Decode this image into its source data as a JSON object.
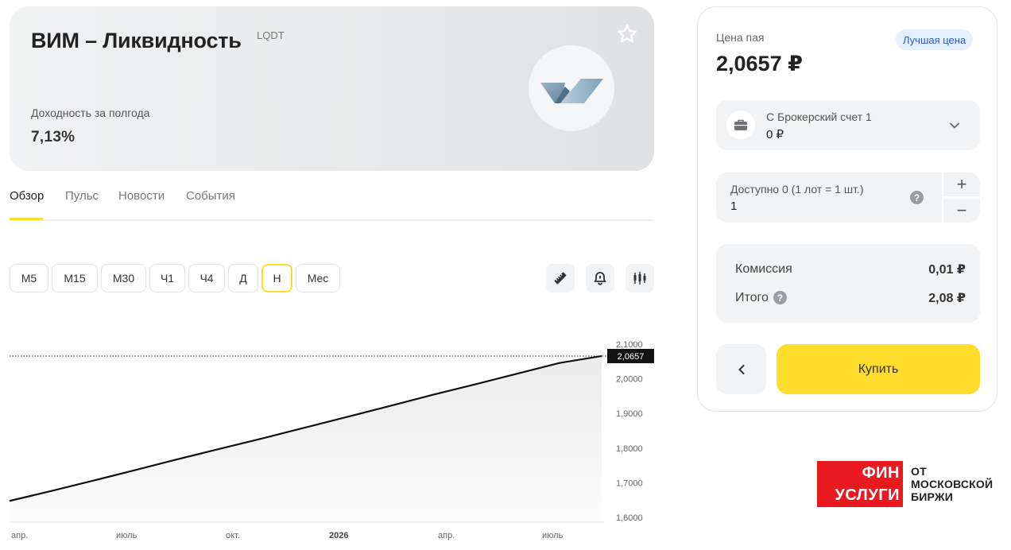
{
  "hero": {
    "title": "ВИМ – Ликвидность",
    "ticker": "LQDT",
    "yield_label": "Доходность за полгода",
    "yield_value": "7,13%"
  },
  "tabs": [
    {
      "label": "Обзор",
      "active": true
    },
    {
      "label": "Пульс",
      "active": false
    },
    {
      "label": "Новости",
      "active": false
    },
    {
      "label": "События",
      "active": false
    }
  ],
  "periods": [
    {
      "label": "M5",
      "active": false
    },
    {
      "label": "M15",
      "active": false
    },
    {
      "label": "M30",
      "active": false
    },
    {
      "label": "Ч1",
      "active": false
    },
    {
      "label": "Ч4",
      "active": false
    },
    {
      "label": "Д",
      "active": false
    },
    {
      "label": "Н",
      "active": true
    },
    {
      "label": "Мес",
      "active": false
    }
  ],
  "tools": [
    "ruler-icon",
    "bell-icon",
    "candles-icon"
  ],
  "chart_data": {
    "type": "line",
    "x_tick_labels": [
      "апр.",
      "июль",
      "окт.",
      "2026",
      "апр.",
      "июль"
    ],
    "y_tick_labels": [
      "2,1000",
      "2,0000",
      "1,9000",
      "1,8000",
      "1,7000",
      "1,6000"
    ],
    "ylim": [
      1.6,
      2.1
    ],
    "current_value": 2.0657,
    "current_label": "2,0657",
    "series": [
      {
        "values": [
          1.6476,
          1.6767,
          1.7067,
          1.7376,
          1.7686,
          1.7987,
          1.8287,
          1.8597,
          1.8907,
          1.9217,
          1.9537,
          1.9837,
          2.0147,
          2.0457,
          2.0657
        ]
      }
    ],
    "grid": false,
    "line_color": "#111111",
    "fill_color": "#e9e9ea"
  },
  "order": {
    "price_label": "Цена пая",
    "price_value": "2,0657 ₽",
    "badge": "Лучшая цена",
    "account_name": "С Брокерский счет 1",
    "account_balance": "0 ₽",
    "qty_label": "Доступно 0 (1 лот = 1 шт.)",
    "qty_value": "1",
    "plus": "+",
    "minus": "−",
    "commission_label": "Комиссия",
    "commission_value": "0,01 ₽",
    "total_label": "Итого",
    "total_value": "2,08 ₽",
    "buy_label": "Купить",
    "help_glyph": "?"
  },
  "brand": {
    "line1": "ФИН",
    "line2": "УСЛУГИ",
    "text1": "ОТ",
    "text2": "МОСКОВСКОЙ",
    "text3": "БИРЖИ"
  },
  "colors": {
    "accent": "#ffdd2d",
    "badge_bg": "#e6efff",
    "badge_text": "#2d59c4",
    "brand_red": "#e8191f"
  }
}
